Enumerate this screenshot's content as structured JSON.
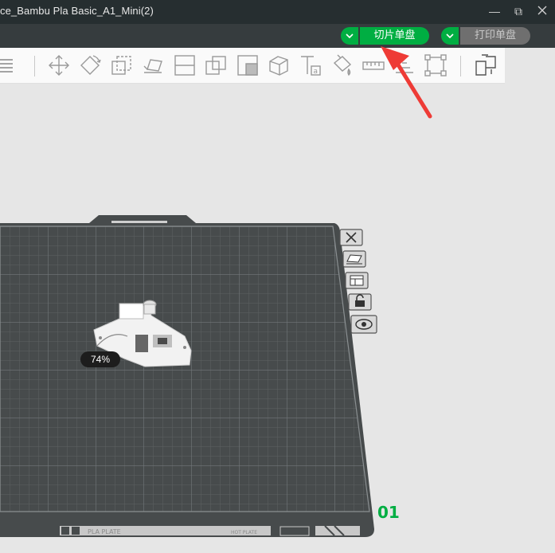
{
  "window": {
    "title": "ce_Bambu Pla Basic_A1_Mini(2)",
    "minimize_glyph": "—",
    "restore_glyph": "⧉"
  },
  "header": {
    "slice_button_label": "切片单盘",
    "print_button_label": "打印单盘",
    "slice_dropdown_icon": "chevron-down-icon",
    "print_dropdown_icon": "chevron-down-icon"
  },
  "toolbar": {
    "tools": [
      "menu-lines-icon",
      "move-icon",
      "rotate-icon",
      "scale-icon",
      "lay-on-face-icon",
      "cut-icon",
      "boolean-icon",
      "support-paint-icon",
      "seam-paint-icon",
      "text-icon",
      "color-paint-icon",
      "measure-icon",
      "assembly-icon",
      "bounding-icon",
      "split-parts-icon"
    ]
  },
  "viewport": {
    "side_icons": [
      "close-plate-icon",
      "auto-arrange-icon",
      "plate-settings-icon",
      "lock-icon",
      "visibility-icon"
    ],
    "model_progress": "74%",
    "plate_number": "01",
    "plate_label_left": "PLA PLATE",
    "plate_label_right": "HOT PLATE"
  },
  "colors": {
    "accent": "#00ae42",
    "titlebar": "#262e30",
    "menubar": "#363c3e",
    "plate": "#474b4c",
    "canvas": "#e6e6e6",
    "arrow": "#ee3b36"
  }
}
